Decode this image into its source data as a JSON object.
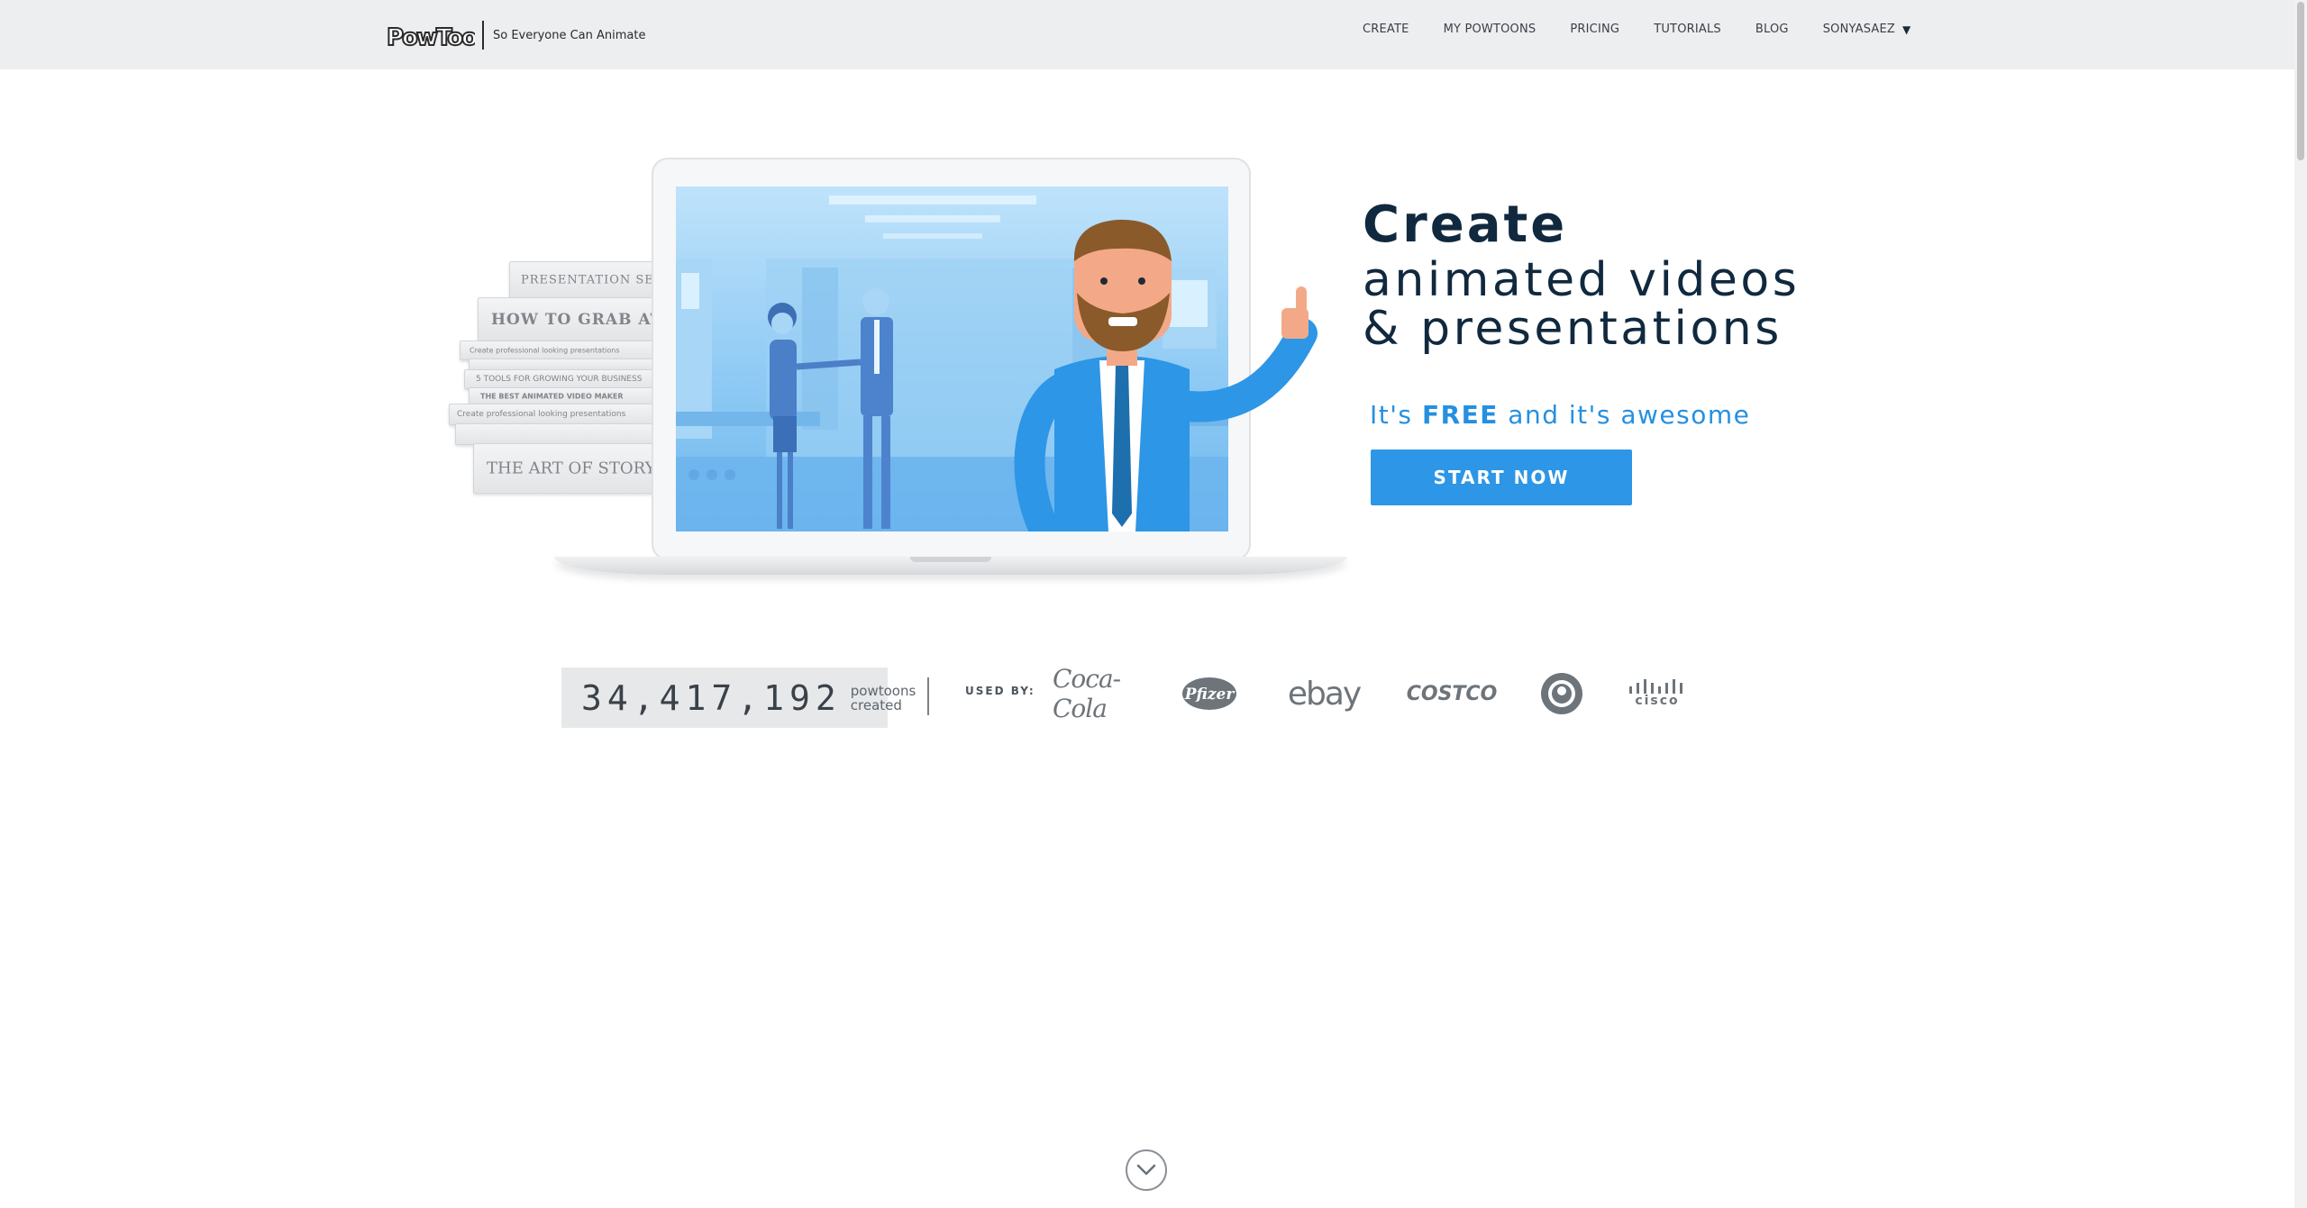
{
  "header": {
    "logo_text": "PowToon",
    "tagline": "So Everyone Can Animate",
    "nav": [
      "CREATE",
      "MY POWTOONS",
      "PRICING",
      "TUTORIALS",
      "BLOG"
    ],
    "user": "SONYASAEZ",
    "user_icon": "caret-down-icon"
  },
  "hero": {
    "title": "Create",
    "subtitle_line1": "animated videos",
    "subtitle_line2": "& presentations",
    "free_prefix": "It's",
    "free_word": "FREE",
    "free_suffix": "and it's awesome",
    "cta": "START NOW",
    "books": [
      "PRESENTATION SECRETS",
      "HOW TO GRAB ATTENTION",
      "Create professional looking presentations",
      "5 TOOLS FOR GROWING YOUR BUSINESS",
      "THE BEST ANIMATED VIDEO MAKER",
      "Create professional looking presentations",
      "THE ART OF STORY TELLING"
    ]
  },
  "stats": {
    "count": "34,417,192",
    "count_label_1": "powtoons",
    "count_label_2": "created",
    "used_by": "USED BY:",
    "brands": [
      "Coca-Cola",
      "Pfizer",
      "ebay",
      "COSTCO",
      "cisco"
    ]
  },
  "colors": {
    "accent": "#2d96e6",
    "header_bg": "#eceef0",
    "title": "#11293e"
  }
}
